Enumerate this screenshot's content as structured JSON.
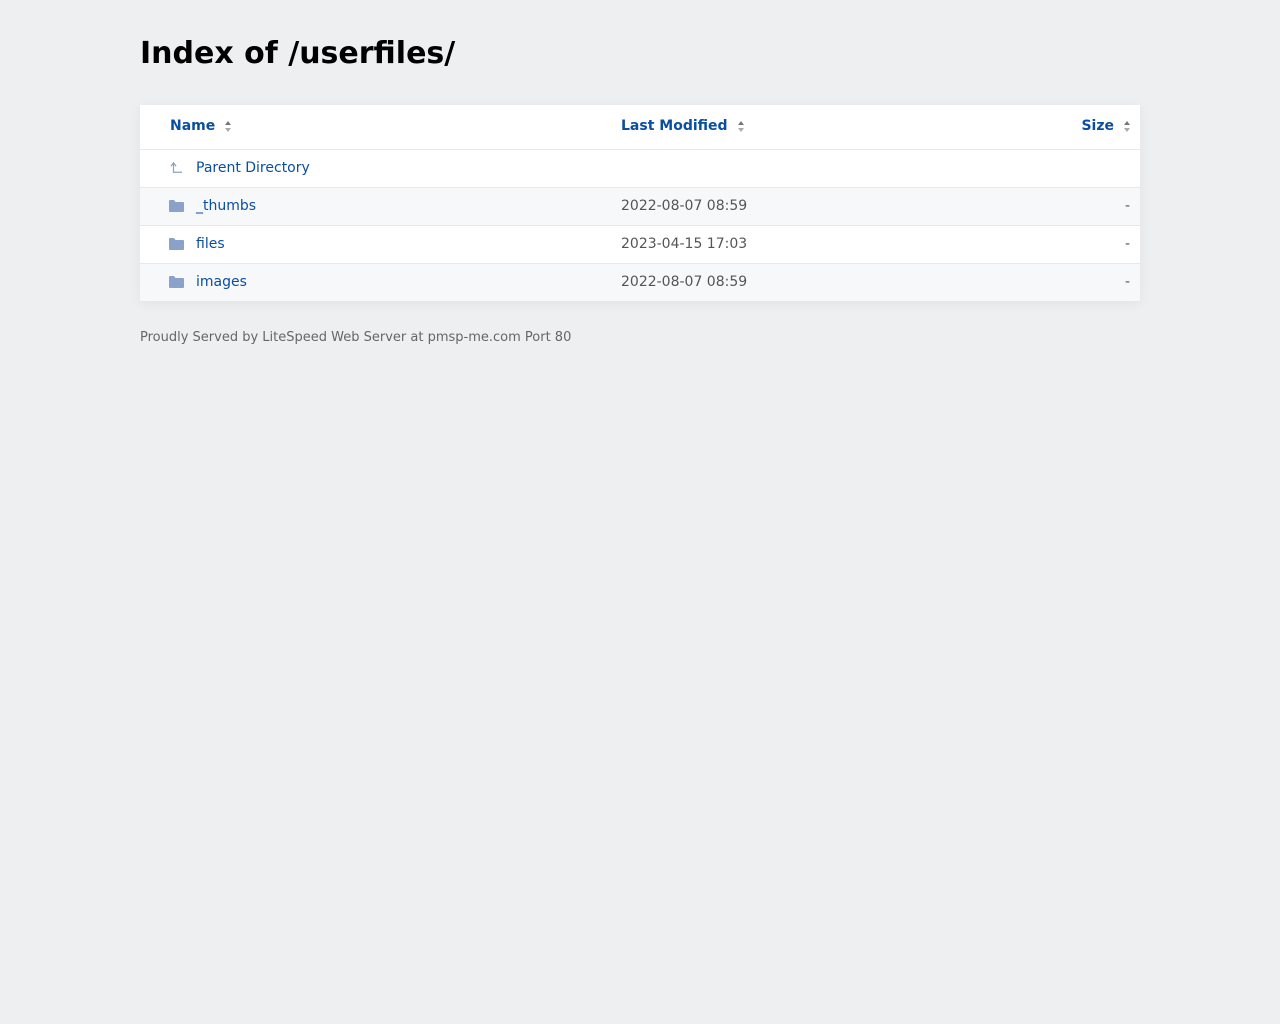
{
  "title": "Index of /userfiles/",
  "headers": {
    "name": "Name",
    "modified": "Last Modified",
    "size": "Size"
  },
  "parent": "Parent Directory",
  "rows": [
    {
      "name": "_thumbs",
      "modified": "2022-08-07 08:59",
      "size": "-"
    },
    {
      "name": "files",
      "modified": "2023-04-15 17:03",
      "size": "-"
    },
    {
      "name": "images",
      "modified": "2022-08-07 08:59",
      "size": "-"
    }
  ],
  "footer": "Proudly Served by LiteSpeed Web Server at pmsp-me.com Port 80"
}
